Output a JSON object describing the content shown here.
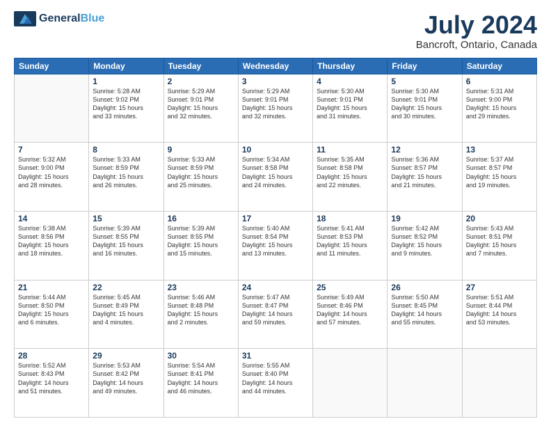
{
  "header": {
    "logo_line1": "General",
    "logo_line2": "Blue",
    "main_title": "July 2024",
    "subtitle": "Bancroft, Ontario, Canada"
  },
  "days_of_week": [
    "Sunday",
    "Monday",
    "Tuesday",
    "Wednesday",
    "Thursday",
    "Friday",
    "Saturday"
  ],
  "weeks": [
    [
      {
        "day": "",
        "content": ""
      },
      {
        "day": "1",
        "content": "Sunrise: 5:28 AM\nSunset: 9:02 PM\nDaylight: 15 hours\nand 33 minutes."
      },
      {
        "day": "2",
        "content": "Sunrise: 5:29 AM\nSunset: 9:01 PM\nDaylight: 15 hours\nand 32 minutes."
      },
      {
        "day": "3",
        "content": "Sunrise: 5:29 AM\nSunset: 9:01 PM\nDaylight: 15 hours\nand 32 minutes."
      },
      {
        "day": "4",
        "content": "Sunrise: 5:30 AM\nSunset: 9:01 PM\nDaylight: 15 hours\nand 31 minutes."
      },
      {
        "day": "5",
        "content": "Sunrise: 5:30 AM\nSunset: 9:01 PM\nDaylight: 15 hours\nand 30 minutes."
      },
      {
        "day": "6",
        "content": "Sunrise: 5:31 AM\nSunset: 9:00 PM\nDaylight: 15 hours\nand 29 minutes."
      }
    ],
    [
      {
        "day": "7",
        "content": "Sunrise: 5:32 AM\nSunset: 9:00 PM\nDaylight: 15 hours\nand 28 minutes."
      },
      {
        "day": "8",
        "content": "Sunrise: 5:33 AM\nSunset: 8:59 PM\nDaylight: 15 hours\nand 26 minutes."
      },
      {
        "day": "9",
        "content": "Sunrise: 5:33 AM\nSunset: 8:59 PM\nDaylight: 15 hours\nand 25 minutes."
      },
      {
        "day": "10",
        "content": "Sunrise: 5:34 AM\nSunset: 8:58 PM\nDaylight: 15 hours\nand 24 minutes."
      },
      {
        "day": "11",
        "content": "Sunrise: 5:35 AM\nSunset: 8:58 PM\nDaylight: 15 hours\nand 22 minutes."
      },
      {
        "day": "12",
        "content": "Sunrise: 5:36 AM\nSunset: 8:57 PM\nDaylight: 15 hours\nand 21 minutes."
      },
      {
        "day": "13",
        "content": "Sunrise: 5:37 AM\nSunset: 8:57 PM\nDaylight: 15 hours\nand 19 minutes."
      }
    ],
    [
      {
        "day": "14",
        "content": "Sunrise: 5:38 AM\nSunset: 8:56 PM\nDaylight: 15 hours\nand 18 minutes."
      },
      {
        "day": "15",
        "content": "Sunrise: 5:39 AM\nSunset: 8:55 PM\nDaylight: 15 hours\nand 16 minutes."
      },
      {
        "day": "16",
        "content": "Sunrise: 5:39 AM\nSunset: 8:55 PM\nDaylight: 15 hours\nand 15 minutes."
      },
      {
        "day": "17",
        "content": "Sunrise: 5:40 AM\nSunset: 8:54 PM\nDaylight: 15 hours\nand 13 minutes."
      },
      {
        "day": "18",
        "content": "Sunrise: 5:41 AM\nSunset: 8:53 PM\nDaylight: 15 hours\nand 11 minutes."
      },
      {
        "day": "19",
        "content": "Sunrise: 5:42 AM\nSunset: 8:52 PM\nDaylight: 15 hours\nand 9 minutes."
      },
      {
        "day": "20",
        "content": "Sunrise: 5:43 AM\nSunset: 8:51 PM\nDaylight: 15 hours\nand 7 minutes."
      }
    ],
    [
      {
        "day": "21",
        "content": "Sunrise: 5:44 AM\nSunset: 8:50 PM\nDaylight: 15 hours\nand 6 minutes."
      },
      {
        "day": "22",
        "content": "Sunrise: 5:45 AM\nSunset: 8:49 PM\nDaylight: 15 hours\nand 4 minutes."
      },
      {
        "day": "23",
        "content": "Sunrise: 5:46 AM\nSunset: 8:48 PM\nDaylight: 15 hours\nand 2 minutes."
      },
      {
        "day": "24",
        "content": "Sunrise: 5:47 AM\nSunset: 8:47 PM\nDaylight: 14 hours\nand 59 minutes."
      },
      {
        "day": "25",
        "content": "Sunrise: 5:49 AM\nSunset: 8:46 PM\nDaylight: 14 hours\nand 57 minutes."
      },
      {
        "day": "26",
        "content": "Sunrise: 5:50 AM\nSunset: 8:45 PM\nDaylight: 14 hours\nand 55 minutes."
      },
      {
        "day": "27",
        "content": "Sunrise: 5:51 AM\nSunset: 8:44 PM\nDaylight: 14 hours\nand 53 minutes."
      }
    ],
    [
      {
        "day": "28",
        "content": "Sunrise: 5:52 AM\nSunset: 8:43 PM\nDaylight: 14 hours\nand 51 minutes."
      },
      {
        "day": "29",
        "content": "Sunrise: 5:53 AM\nSunset: 8:42 PM\nDaylight: 14 hours\nand 49 minutes."
      },
      {
        "day": "30",
        "content": "Sunrise: 5:54 AM\nSunset: 8:41 PM\nDaylight: 14 hours\nand 46 minutes."
      },
      {
        "day": "31",
        "content": "Sunrise: 5:55 AM\nSunset: 8:40 PM\nDaylight: 14 hours\nand 44 minutes."
      },
      {
        "day": "",
        "content": ""
      },
      {
        "day": "",
        "content": ""
      },
      {
        "day": "",
        "content": ""
      }
    ]
  ]
}
